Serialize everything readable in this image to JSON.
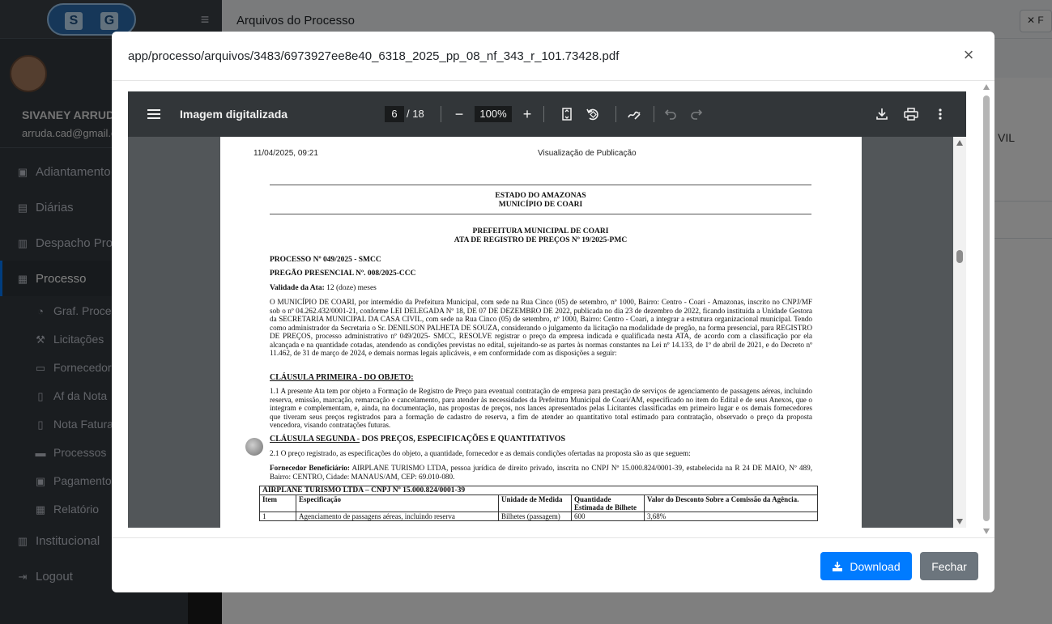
{
  "app": {
    "logo_text": "SG",
    "header_title": "Arquivos do Processo",
    "header_close_label": "F",
    "user_name": "SIVANEY ARRUDA",
    "user_email": "arruda.cad@gmail.com",
    "content_text": "VIL",
    "sidebar_items": [
      {
        "label": "Adiantamento",
        "icon": "money-icon"
      },
      {
        "label": "Diárias",
        "icon": "briefcase-icon"
      },
      {
        "label": "Despacho Processo",
        "icon": "document-icon"
      },
      {
        "label": "Processo",
        "icon": "id-card-icon",
        "active": true
      }
    ],
    "sidebar_subitems": [
      {
        "label": "Graf. Processos",
        "icon": "pie-chart-icon"
      },
      {
        "label": "Licitações",
        "icon": "gavel-icon"
      },
      {
        "label": "Fornecedores",
        "icon": "address-card-icon"
      },
      {
        "label": "Af da Nota",
        "icon": "file-icon"
      },
      {
        "label": "Nota Fatura",
        "icon": "file-invoice-icon"
      },
      {
        "label": "Processos",
        "icon": "folder-icon"
      },
      {
        "label": "Pagamentos",
        "icon": "money-bill-icon"
      },
      {
        "label": "Relatório",
        "icon": "calculator-icon"
      }
    ],
    "sidebar_bottom_items": [
      {
        "label": "Institucional",
        "icon": "building-icon"
      },
      {
        "label": "Logout",
        "icon": "logout-icon"
      }
    ]
  },
  "modal": {
    "title": "app/processo/arquivos/3483/6973927ee8e40_6318_2025_pp_08_nf_343_r_101.73428.pdf",
    "close_symbol": "×",
    "download_label": "Download",
    "fechar_label": "Fechar"
  },
  "viewer": {
    "title": "Imagem digitalizada",
    "page_current": "6",
    "page_total": "/ 18",
    "zoom": "100%",
    "zoom_out_symbol": "−",
    "zoom_in_symbol": "+"
  },
  "document": {
    "print_date": "11/04/2025, 09:21",
    "print_title": "Visualização de Publicação",
    "state": "ESTADO DO AMAZONAS",
    "municipality": "MUNICÍPIO DE COARI",
    "prefeitura": "PREFEITURA MUNICIPAL DE COARI",
    "ata": "ATA DE REGISTRO DE PREÇOS Nº 19/2025-PMC",
    "processo": "PROCESSO Nº 049/2025 - SMCC",
    "pregao": "PREGÃO PRESENCIAL Nº. 008/2025-CCC",
    "validade_label": "Validade da Ata:",
    "validade_value": " 12 (doze) meses",
    "intro": "O MUNICÍPIO DE COARI, por intermédio da Prefeitura Municipal, com sede na Rua Cinco (05) de setembro, nº 1000, Bairro: Centro - Coari - Amazonas, inscrito no CNPJ/MF sob o nº 04.262.432/0001-21, conforme LEI DELEGADA Nº 18, DE 07 DE DEZEMBRO DE 2022, publicada no dia 23 de dezembro de 2022, ficando instituída a Unidade Gestora da SECRETARIA MUNICIPAL DA CASA CIVIL, com sede na Rua Cinco (05) de setembro, nº 1000, Bairro: Centro - Coari, a integrar a estrutura organizacional municipal. Tendo como administrador da Secretaria o Sr. DENILSON PALHETA DE SOUZA, considerando o julgamento da licitação na modalidade de pregão, na forma presencial, para REGISTRO DE PREÇOS, processo administrativo nº 049/2025- SMCC, RESOLVE registrar o preço da empresa indicada e qualificada nesta ATA, de acordo com a classificação por ela alcançada e na quantidade cotadas, atendendo as condições previstas no edital, sujeitando-se as partes às normas constantes na Lei nº 14.133, de 1º de abril de 2021, e do Decreto nº 11.462, de 31 de março de 2024, e demais normas legais aplicáveis, e em conformidade com as disposições a seguir:",
    "clausula1_title": "CLÁUSULA PRIMEIRA - DO OBJETO:",
    "clausula1_text": "1.1 A presente Ata tem por objeto a Formação de Registro de Preço para eventual contratação de empresa para prestação de serviços de agenciamento de passagens aéreas, incluindo reserva, emissão, marcação, remarcação e cancelamento, para atender às necessidades da Prefeitura Municipal de Coari/AM, especificado no item do Edital e de seus Anexos, que o integram e complementam, e, ainda, na documentação, nas propostas de preços, nos lances apresentados pelas Licitantes classificadas em primeiro lugar e os demais fornecedores que tiveram seus preços registrados para a formação de cadastro de reserva, a fim de atender ao quantitativo total estimado para contratação, observado o preço da proposta vencedora, visando contratações futuras.",
    "clausula2_title_u": "CLÁUSULA SEGUNDA -",
    "clausula2_title_rest": " DOS PREÇOS, ESPECIFICAÇÕES E QUANTITATIVOS",
    "clausula2_text": "2.1 O preço registrado, as especificações do objeto, a quantidade, fornecedor e as demais condições ofertadas na proposta são as que seguem:",
    "fornecedor_label": "Fornecedor Beneficiário:",
    "fornecedor_text": " AIRPLANE TURISMO LTDA, pessoa jurídica de direito privado, inscrita no CNPJ Nº 15.000.824/0001-39, estabelecida na R 24 DE MAIO, Nº 489, Bairro: CENTRO, Cidade: MANAUS/AM, CEP: 69.010-080.",
    "table_caption": "AIRPLANE TURISMO LTDA – CNPJ Nº 15.000.824/0001-39",
    "table_headers": [
      "Item",
      "Especificação",
      "Unidade de Medida",
      "Quantidade Estimada de Bilhete",
      "Valor do Desconto Sobre a Comissão da Agência."
    ],
    "table_row": [
      "1",
      "Agenciamento de passagens aéreas, incluindo reserva",
      "Bilhetes (passagem)",
      "600",
      "3,68%"
    ]
  }
}
